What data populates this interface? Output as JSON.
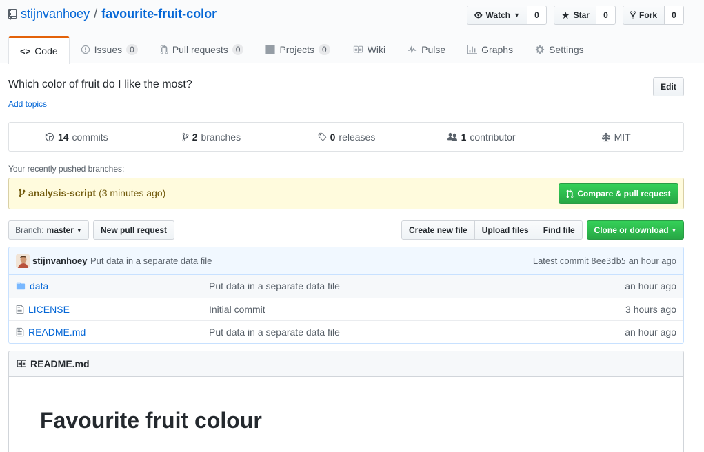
{
  "repo": {
    "owner": "stijnvanhoey",
    "separator": "/",
    "name": "favourite-fruit-color"
  },
  "social": {
    "watch_label": "Watch",
    "watch_count": "0",
    "star_label": "Star",
    "star_count": "0",
    "fork_label": "Fork",
    "fork_count": "0"
  },
  "tabs": [
    {
      "label": "Code",
      "icon": "code-icon"
    },
    {
      "label": "Issues",
      "count": "0",
      "icon": "issue-icon"
    },
    {
      "label": "Pull requests",
      "count": "0",
      "icon": "pull-request-icon"
    },
    {
      "label": "Projects",
      "count": "0",
      "icon": "project-icon"
    },
    {
      "label": "Wiki",
      "icon": "book-icon"
    },
    {
      "label": "Pulse",
      "icon": "pulse-icon"
    },
    {
      "label": "Graphs",
      "icon": "graph-icon"
    },
    {
      "label": "Settings",
      "icon": "gear-icon"
    }
  ],
  "description": "Which color of fruit do I like the most?",
  "add_topics": "Add topics",
  "edit_label": "Edit",
  "summary": {
    "commits_count": "14",
    "commits_label": "commits",
    "branches_count": "2",
    "branches_label": "branches",
    "releases_count": "0",
    "releases_label": "releases",
    "contributors_count": "1",
    "contributors_label": "contributor",
    "license": "MIT"
  },
  "recent": {
    "label": "Your recently pushed branches:",
    "branch": "analysis-script",
    "time": "(3 minutes ago)",
    "compare_label": "Compare & pull request"
  },
  "branch_select": {
    "prefix": "Branch:",
    "value": "master"
  },
  "new_pr_label": "New pull request",
  "file_actions": {
    "create": "Create new file",
    "upload": "Upload files",
    "find": "Find file"
  },
  "clone_label": "Clone or download",
  "latest_commit": {
    "author": "stijnvanhoey",
    "message": "Put data in a separate data file",
    "prefix": "Latest commit",
    "sha": "8ee3db5",
    "time": "an hour ago"
  },
  "files": [
    {
      "name": "data",
      "type": "folder",
      "message": "Put data in a separate data file",
      "age": "an hour ago"
    },
    {
      "name": "LICENSE",
      "type": "file",
      "message": "Initial commit",
      "age": "3 hours ago"
    },
    {
      "name": "README.md",
      "type": "file",
      "message": "Put data in a separate data file",
      "age": "an hour ago"
    }
  ],
  "readme": {
    "filename": "README.md",
    "heading": "Favourite fruit colour"
  },
  "colors": {
    "link": "#0366d6",
    "green": "#28a745",
    "tab_accent": "#e36209",
    "recent_bg": "#fffbdd"
  }
}
